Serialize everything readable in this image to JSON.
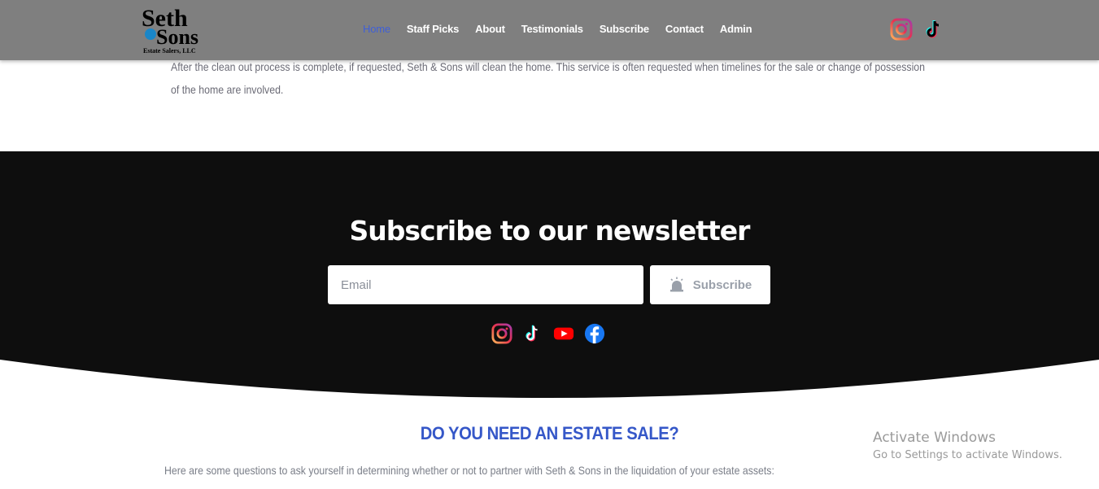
{
  "intro": {
    "text": "After the clean out process is complete, if requested, Seth & Sons will clean the home. This service is often requested when timelines for the sale or change of possession of the home are involved."
  },
  "header": {
    "logo_text_1": "Seth",
    "logo_text_2": "Sons",
    "logo_text_3": "Estate Salers, LLC",
    "nav": [
      {
        "label": "Home"
      },
      {
        "label": "Staff Picks"
      },
      {
        "label": "About"
      },
      {
        "label": "Testimonials"
      },
      {
        "label": "Subscribe"
      },
      {
        "label": "Contact"
      },
      {
        "label": "Admin"
      }
    ],
    "social_icons": [
      "instagram-icon",
      "tiktok-icon"
    ],
    "active_color": "#3f5fd8",
    "background": "#7f7f7f"
  },
  "newsletter": {
    "title": "Subscribe to our newsletter",
    "email_placeholder": "Email",
    "button_label": "Subscribe",
    "social_icons": [
      "instagram-icon",
      "tiktok-icon",
      "youtube-icon",
      "facebook-icon"
    ],
    "background": "#0e0e0e"
  },
  "estate": {
    "title": "DO YOU NEED AN ESTATE SALE?",
    "text": "Here are some questions to ask yourself in determining whether or not to partner with Seth & Sons in the liquidation of your estate assets:",
    "title_color": "#3557c8"
  },
  "watermark": {
    "line1": "Activate Windows",
    "line2": "Go to Settings to activate Windows."
  }
}
